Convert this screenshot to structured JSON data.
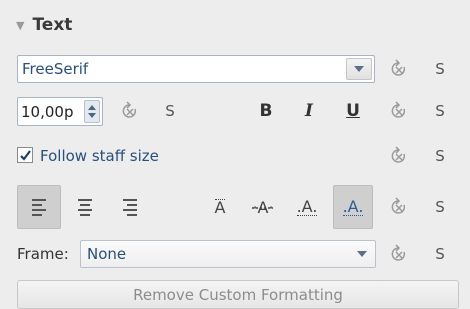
{
  "section": {
    "title": "Text"
  },
  "font": {
    "value": "FreeSerif"
  },
  "size": {
    "value": "10,00p"
  },
  "style": {
    "bold": "B",
    "italic": "I",
    "underline": "U"
  },
  "follow_staff": {
    "label": "Follow staff size",
    "checked": true
  },
  "alignment": {
    "selected": "left"
  },
  "position": {
    "selected": "subscript"
  },
  "frame": {
    "label": "Frame:",
    "value": "None"
  },
  "s_label": "S",
  "remove_button": {
    "label": "Remove Custom Formatting"
  },
  "colors": {
    "field_text": "#28507c",
    "active_bg": "#cfcfcf"
  }
}
